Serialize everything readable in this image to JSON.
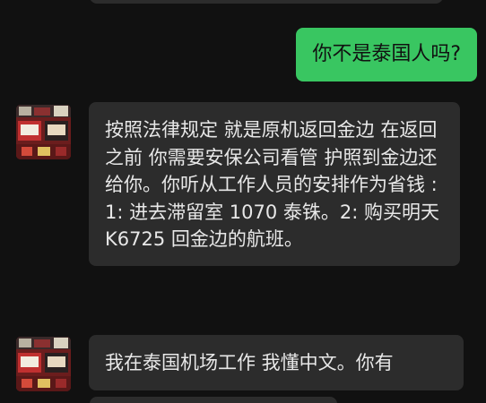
{
  "chat": {
    "messages": [
      {
        "side": "outgoing",
        "text": "你不是泰国人吗?"
      },
      {
        "side": "incoming",
        "text": "按照法律规定 就是原机返回金边 在返回之前 你需要安保公司看管 护照到金边还给你。你听从工作人员的安排作为省钱 : 1: 进去滞留室 1070 泰铢。2: 购买明天 K6725 回金边的航班。"
      },
      {
        "side": "incoming",
        "text": "我在泰国机场工作 我懂中文。你有"
      }
    ]
  },
  "colors": {
    "background": "#111111",
    "outgoing_bubble": "#39c661",
    "incoming_bubble": "#2c2c2c",
    "incoming_text": "#e8e8e8"
  }
}
